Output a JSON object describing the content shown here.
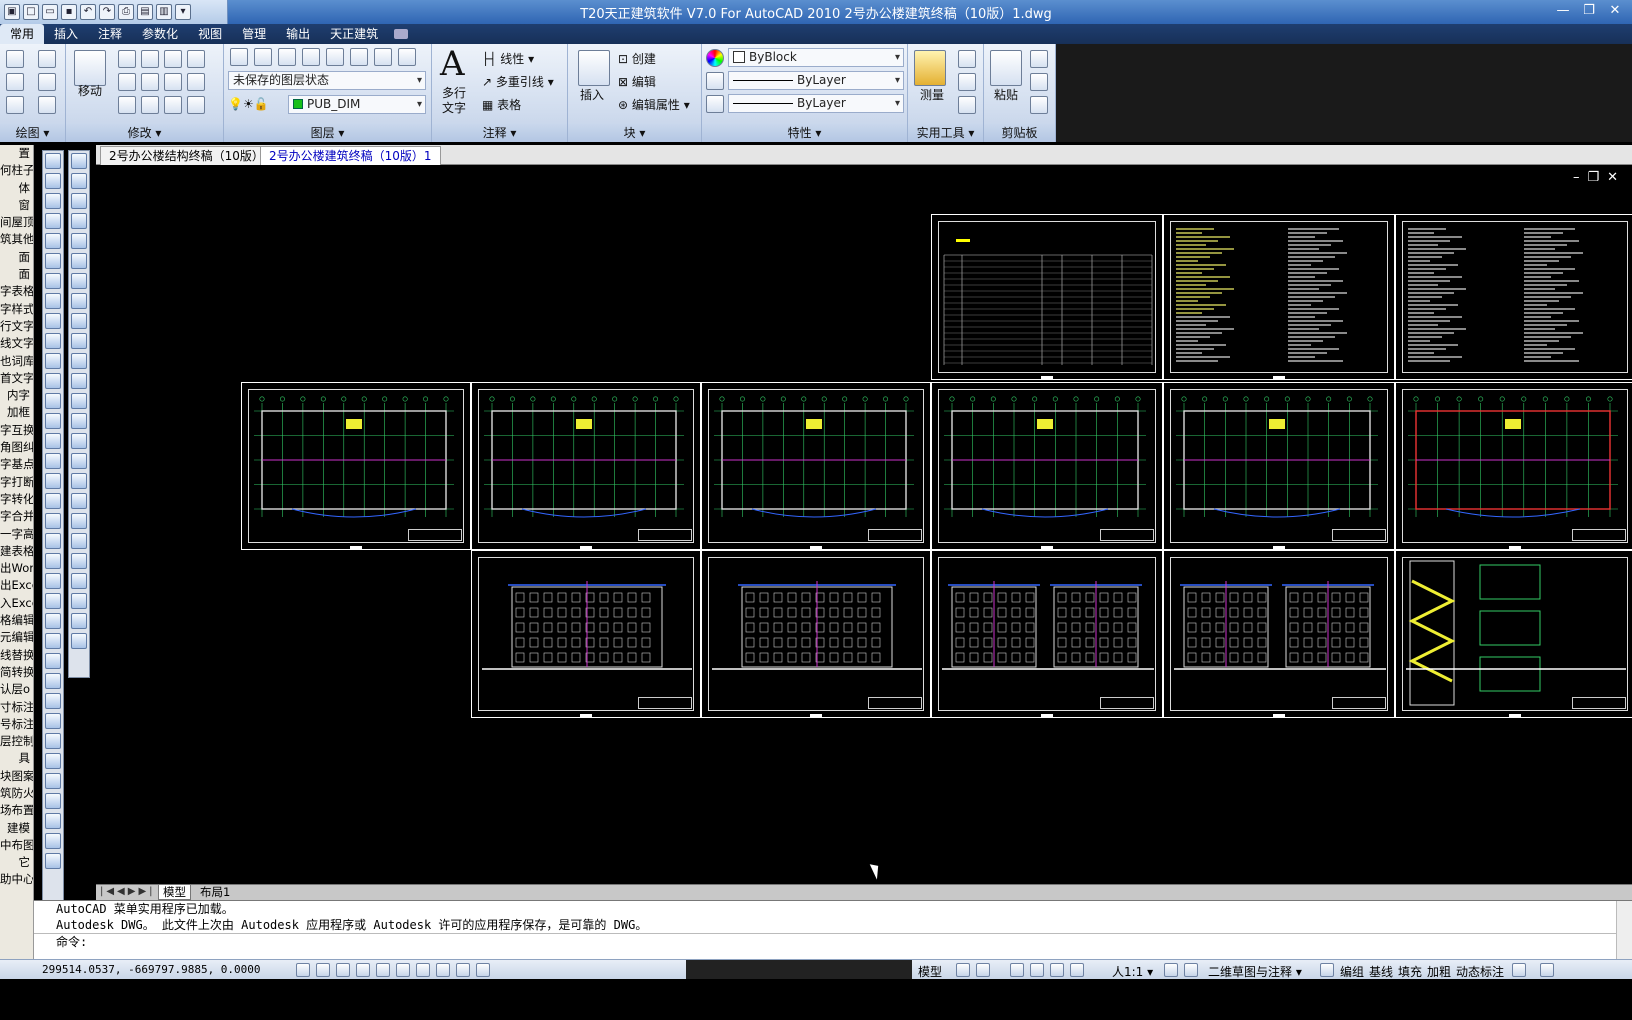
{
  "window": {
    "title": "T20天正建筑软件 V7.0 For AutoCAD 2010      2号办公楼建筑终稿（10版）1.dwg",
    "controls": [
      "—",
      "❐",
      "✕"
    ]
  },
  "ribbon_tabs": [
    {
      "label": "常用",
      "active": true
    },
    {
      "label": "插入"
    },
    {
      "label": "注释"
    },
    {
      "label": "参数化"
    },
    {
      "label": "视图"
    },
    {
      "label": "管理"
    },
    {
      "label": "输出"
    },
    {
      "label": "天正建筑"
    }
  ],
  "ribbon": {
    "draw": {
      "label": "绘图 ▾"
    },
    "modify": {
      "label": "修改 ▾",
      "move_label": "移动"
    },
    "layers": {
      "label": "图层 ▾",
      "layer_state": "未保存的图层状态",
      "current_layer": "PUB_DIM"
    },
    "annotation": {
      "label": "注释 ▾",
      "mtext_line1": "多行",
      "mtext_line2": "文字",
      "linear": "线性",
      "mleader": "多重引线",
      "table": "表格"
    },
    "block": {
      "label": "块 ▾",
      "insert": "插入",
      "create": "创建",
      "edit": "编辑",
      "edit_attr": "编辑属性"
    },
    "properties": {
      "label": "特性 ▾",
      "color": "ByBlock",
      "linetype": "ByLayer",
      "lineweight": "ByLayer"
    },
    "utilities": {
      "label": "实用工具 ▾",
      "measure": "测量"
    },
    "clipboard": {
      "label": "剪贴板",
      "paste": "粘贴"
    }
  },
  "doc_tabs": [
    {
      "label": "2号办公楼结构终稿（10版）",
      "active": false
    },
    {
      "label": "2号办公楼建筑终稿（10版）1",
      "active": true
    }
  ],
  "left_menu": [
    "置",
    "何柱子",
    "体",
    "窗",
    "间屋顶",
    "筑其他",
    "面",
    "面",
    "字表格",
    "字样式",
    "行文字",
    "线文字",
    "也词库",
    "首文字",
    "内字",
    "加框",
    "字互换",
    "角图纠",
    "字基点",
    "字打断",
    "字转化",
    "字合并",
    "一字高",
    "建表格",
    "出Word",
    "出Excel",
    "入Excel",
    "格编辑",
    "元编辑",
    "线替换",
    "简转换",
    "认层o",
    "寸标注",
    "号标注",
    "层控制",
    "具",
    "块图案",
    "筑防火",
    "场布置",
    "建模",
    "中布图",
    "它",
    "助中心"
  ],
  "model_tabs": [
    {
      "label": "模型",
      "active": true
    },
    {
      "label": "布局1",
      "active": false
    }
  ],
  "command_lines": [
    "AutoCAD 菜单实用程序已加载。",
    "Autodesk DWG。  此文件上次由 Autodesk 应用程序或 Autodesk 许可的应用程序保存，是可靠的 DWG。",
    "命令:"
  ],
  "status": {
    "coordinates": "299514.0537, -669797.9885, 0.0000",
    "items": [
      "模型",
      "人1:1 ▾",
      "二维草图与注释 ▾",
      "编组",
      "基线",
      "填充",
      "加粗",
      "动态标注"
    ]
  },
  "drawing_sheets": {
    "row1": [
      "sheet-cover-table",
      "sheet-notes-1",
      "sheet-notes-2"
    ],
    "row2": [
      "sheet-plan-1",
      "sheet-plan-2",
      "sheet-plan-3",
      "sheet-plan-4",
      "sheet-plan-5",
      "sheet-plan-6"
    ],
    "row3": [
      "sheet-elevation-1",
      "sheet-elevation-2",
      "sheet-section-1",
      "sheet-section-2",
      "sheet-stair-detail"
    ]
  }
}
